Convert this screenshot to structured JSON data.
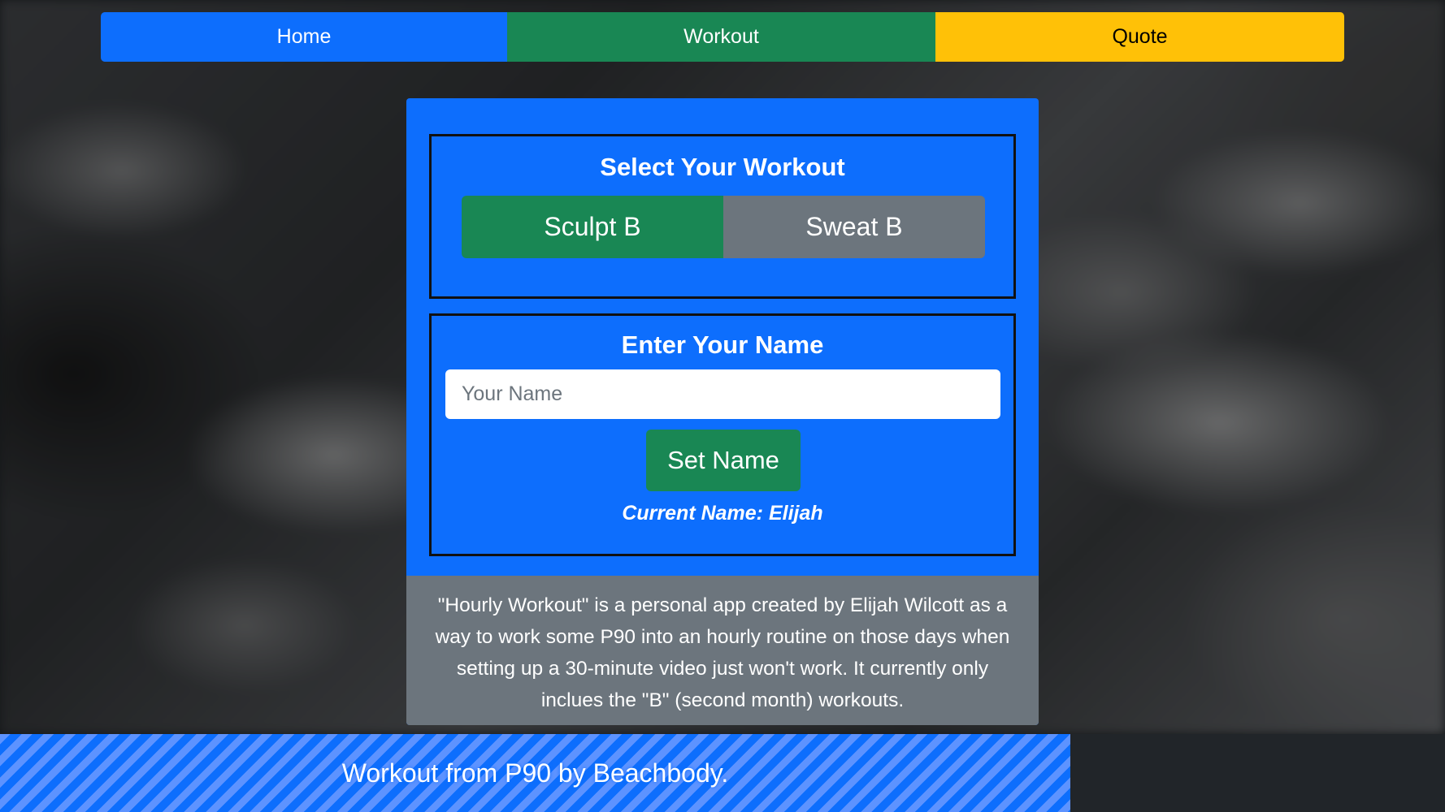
{
  "nav": {
    "home_label": "Home",
    "workout_label": "Workout",
    "quote_label": "Quote"
  },
  "workout_select": {
    "title": "Select Your Workout",
    "options": [
      {
        "label": "Sculpt B",
        "selected": true
      },
      {
        "label": "Sweat B",
        "selected": false
      }
    ]
  },
  "name_form": {
    "title": "Enter Your Name",
    "input_placeholder": "Your Name",
    "input_value": "",
    "submit_label": "Set Name",
    "current_name": "Current Name: Elijah"
  },
  "about": {
    "text": "\"Hourly Workout\" is a personal app created by Elijah Wilcott as a way to work some P90 into an hourly routine on those days when setting up a 30-minute video just won't work. It currently only inclues the \"B\" (second month) workouts."
  },
  "footer": {
    "text": "Workout from P90 by Beachbody."
  },
  "colors": {
    "primary": "#0d6efd",
    "success": "#198754",
    "warning": "#ffc107",
    "secondary": "#6c757d",
    "dark": "#212529"
  }
}
